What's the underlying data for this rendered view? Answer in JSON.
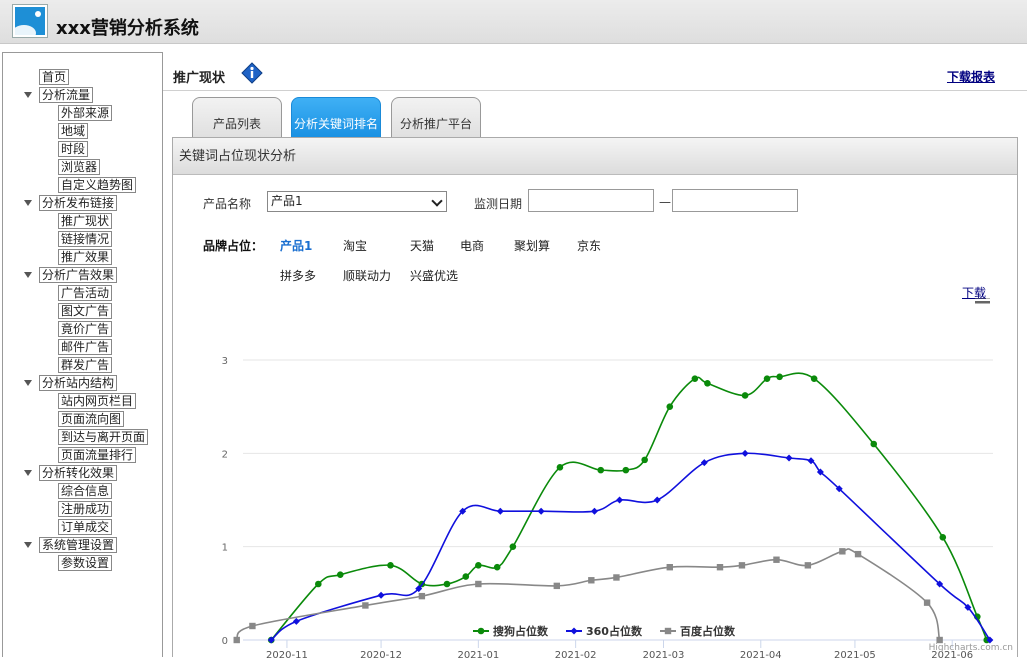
{
  "app": {
    "title": "xxx营销分析系统"
  },
  "sidebar": [
    {
      "label": "首页",
      "level": 0,
      "arrow": false
    },
    {
      "label": "分析流量",
      "level": 0,
      "arrow": true
    },
    {
      "label": "外部来源",
      "level": 1
    },
    {
      "label": "地域",
      "level": 1
    },
    {
      "label": "时段",
      "level": 1
    },
    {
      "label": "浏览器",
      "level": 1
    },
    {
      "label": "自定义趋势图",
      "level": 1
    },
    {
      "label": "分析发布链接",
      "level": 0,
      "arrow": true
    },
    {
      "label": "推广现状",
      "level": 1
    },
    {
      "label": "链接情况",
      "level": 1
    },
    {
      "label": "推广效果",
      "level": 1
    },
    {
      "label": "分析广告效果",
      "level": 0,
      "arrow": true
    },
    {
      "label": "广告活动",
      "level": 1
    },
    {
      "label": "图文广告",
      "level": 1
    },
    {
      "label": "竟价广告",
      "level": 1
    },
    {
      "label": "邮件广告",
      "level": 1
    },
    {
      "label": "群发广告",
      "level": 1
    },
    {
      "label": "分析站内结构",
      "level": 0,
      "arrow": true
    },
    {
      "label": "站内网页栏目",
      "level": 1
    },
    {
      "label": "页面流向图",
      "level": 1
    },
    {
      "label": "到达与离开页面",
      "level": 1
    },
    {
      "label": "页面流量排行",
      "level": 1
    },
    {
      "label": "分析转化效果",
      "level": 0,
      "arrow": true
    },
    {
      "label": "综合信息",
      "level": 1
    },
    {
      "label": "注册成功",
      "level": 1
    },
    {
      "label": "订单成交",
      "level": 1
    },
    {
      "label": "系统管理设置",
      "level": 0,
      "arrow": true
    },
    {
      "label": "参数设置",
      "level": 1
    }
  ],
  "main": {
    "section_title": "推广现状",
    "download_report": "下载报表",
    "tabs": [
      {
        "label": "产品列表",
        "active": false
      },
      {
        "label": "分析关键词排名",
        "active": true
      },
      {
        "label": "分析推广平台",
        "active": false
      }
    ],
    "panel_title": "关键词占位现状分析",
    "filters": {
      "product_label": "产品名称",
      "product_value": "产品1",
      "date_label": "监测日期",
      "date_from": "",
      "date_to": "",
      "date_sep": "—"
    },
    "brand_label": "品牌占位：",
    "brands": [
      {
        "label": "产品1",
        "active": true
      },
      {
        "label": "淘宝",
        "active": false
      },
      {
        "label": "天猫",
        "active": false
      },
      {
        "label": "电商",
        "active": false
      },
      {
        "label": "聚划算",
        "active": false
      },
      {
        "label": "京东",
        "active": false
      },
      {
        "label": "拼多多",
        "active": false
      },
      {
        "label": "顺联动力",
        "active": false
      },
      {
        "label": "兴盛优选",
        "active": false
      }
    ],
    "chart_download": "下载",
    "credits": "Highcharts.com.cn"
  },
  "chart_data": {
    "type": "line",
    "title": "",
    "xlabel": "",
    "ylabel": "",
    "ylim": [
      0,
      3
    ],
    "yticks": [
      0,
      1,
      2,
      3
    ],
    "xlim": [
      "2020-10-18",
      "2021-06-14"
    ],
    "xticks": [
      "2020-11-01",
      "2020-12-01",
      "2021-01-01",
      "2021-02-01",
      "2021-03-01",
      "2021-04-01",
      "2021-05-01",
      "2021-06-01"
    ],
    "xtick_labels": [
      "2020-11",
      "2020-12",
      "2021-01",
      "2021-02",
      "2021-03",
      "2021-04",
      "2021-05",
      "2021-06"
    ],
    "grid": true,
    "legend": "bottom",
    "series": [
      {
        "name": "搜狗占位数",
        "color": "#0a8a0a",
        "marker": "circle",
        "points": [
          [
            "2020-10-27",
            0
          ],
          [
            "2020-11-11",
            0.6
          ],
          [
            "2020-11-18",
            0.7
          ],
          [
            "2020-12-04",
            0.8
          ],
          [
            "2020-12-14",
            0.6
          ],
          [
            "2020-12-22",
            0.6
          ],
          [
            "2020-12-28",
            0.68
          ],
          [
            "2021-01-01",
            0.8
          ],
          [
            "2021-01-07",
            0.78
          ],
          [
            "2021-01-12",
            1.0
          ],
          [
            "2021-01-27",
            1.85
          ],
          [
            "2021-02-09",
            1.82
          ],
          [
            "2021-02-17",
            1.82
          ],
          [
            "2021-02-23",
            1.93
          ],
          [
            "2021-03-03",
            2.5
          ],
          [
            "2021-03-11",
            2.8
          ],
          [
            "2021-03-15",
            2.75
          ],
          [
            "2021-03-27",
            2.62
          ],
          [
            "2021-04-03",
            2.8
          ],
          [
            "2021-04-07",
            2.82
          ],
          [
            "2021-04-18",
            2.8
          ],
          [
            "2021-05-07",
            2.1
          ],
          [
            "2021-05-29",
            1.1
          ],
          [
            "2021-06-09",
            0.25
          ],
          [
            "2021-06-12",
            0
          ]
        ]
      },
      {
        "name": "360占位数",
        "color": "#1010dd",
        "marker": "diamond",
        "points": [
          [
            "2020-10-27",
            0
          ],
          [
            "2020-11-04",
            0.2
          ],
          [
            "2020-12-01",
            0.48
          ],
          [
            "2020-12-13",
            0.55
          ],
          [
            "2020-12-27",
            1.38
          ],
          [
            "2021-01-08",
            1.38
          ],
          [
            "2021-01-21",
            1.38
          ],
          [
            "2021-02-07",
            1.38
          ],
          [
            "2021-02-15",
            1.5
          ],
          [
            "2021-02-27",
            1.5
          ],
          [
            "2021-03-14",
            1.9
          ],
          [
            "2021-03-27",
            2.0
          ],
          [
            "2021-04-10",
            1.95
          ],
          [
            "2021-04-17",
            1.92
          ],
          [
            "2021-04-20",
            1.8
          ],
          [
            "2021-04-26",
            1.62
          ],
          [
            "2021-05-28",
            0.6
          ],
          [
            "2021-06-06",
            0.35
          ],
          [
            "2021-06-13",
            0
          ]
        ]
      },
      {
        "name": "百度占位数",
        "color": "#888888",
        "marker": "square",
        "points": [
          [
            "2020-10-16",
            0
          ],
          [
            "2020-10-21",
            0.15
          ],
          [
            "2020-11-26",
            0.37
          ],
          [
            "2020-12-14",
            0.47
          ],
          [
            "2021-01-01",
            0.6
          ],
          [
            "2021-01-26",
            0.58
          ],
          [
            "2021-02-06",
            0.64
          ],
          [
            "2021-02-14",
            0.67
          ],
          [
            "2021-03-03",
            0.78
          ],
          [
            "2021-03-19",
            0.78
          ],
          [
            "2021-03-26",
            0.8
          ],
          [
            "2021-04-06",
            0.86
          ],
          [
            "2021-04-16",
            0.8
          ],
          [
            "2021-04-27",
            0.95
          ],
          [
            "2021-05-02",
            0.92
          ],
          [
            "2021-05-24",
            0.4
          ],
          [
            "2021-05-28",
            0
          ]
        ]
      }
    ]
  }
}
